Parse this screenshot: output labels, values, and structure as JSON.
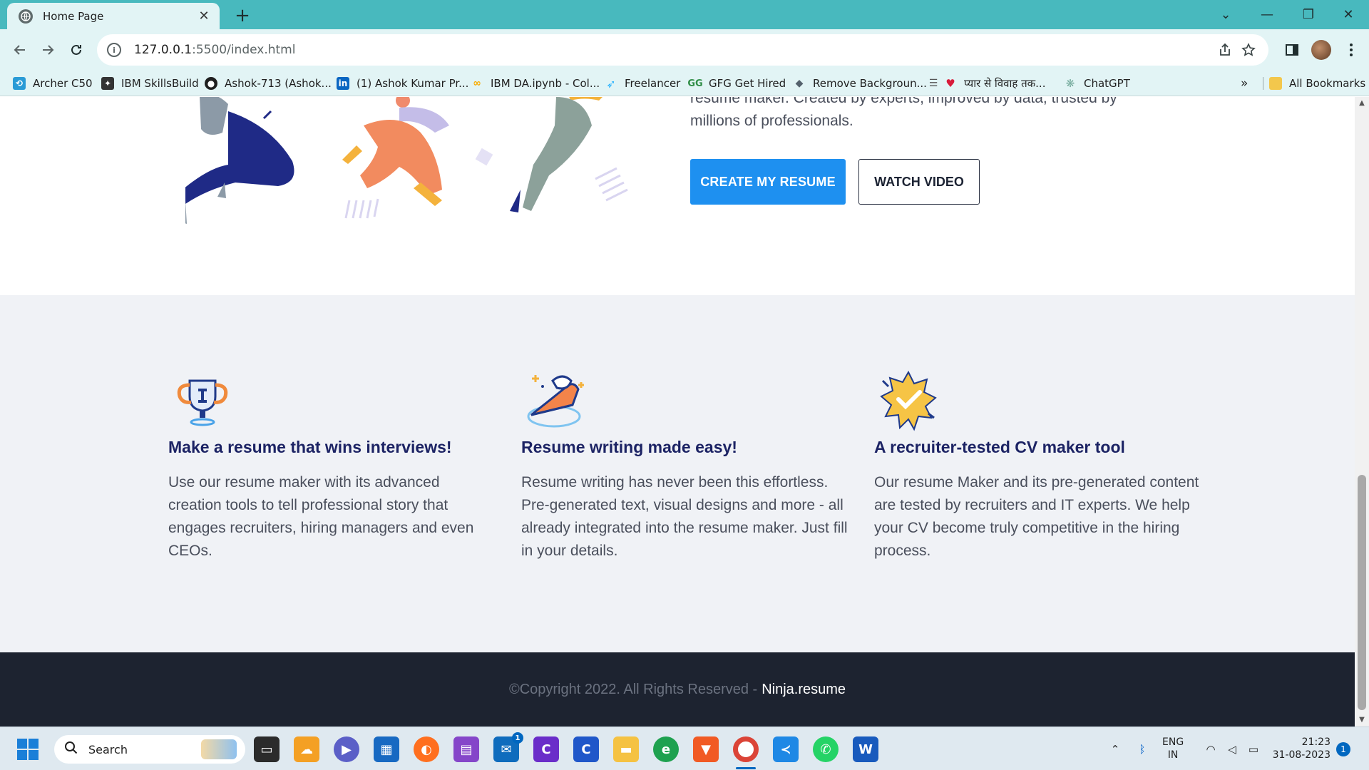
{
  "browser": {
    "tab_title": "Home Page",
    "tab_close": "✕",
    "new_tab": "+",
    "url_host": "127.0.0.1",
    "url_rest": ":5500/index.html",
    "window_controls": {
      "dropdown": "⌄",
      "minimize": "—",
      "restore": "❐",
      "close": "✕"
    }
  },
  "bookmarks": {
    "items": [
      {
        "label": "Archer C50",
        "icon": "tplink-icon",
        "color": "#2a9bd6"
      },
      {
        "label": "IBM SkillsBuild",
        "icon": "ibm-icon",
        "color": "#333333"
      },
      {
        "label": "Ashok-713 (Ashok...",
        "icon": "github-icon",
        "color": "#1f1f1f"
      },
      {
        "label": "(1) Ashok Kumar Pr...",
        "icon": "linkedin-icon",
        "color": "#0a66c2"
      },
      {
        "label": "IBM DA.ipynb - Col...",
        "icon": "colab-icon",
        "color": "#f9ab00"
      },
      {
        "label": "Freelancer",
        "icon": "freelancer-icon",
        "color": "#29b2fe"
      },
      {
        "label": "GFG Get Hired",
        "icon": "gfg-icon",
        "color": "#2f8d46"
      },
      {
        "label": "Remove Backgroun...",
        "icon": "removebg-icon",
        "color": "#54616c"
      },
      {
        "label": "प्यार से विवाह तक...",
        "icon": "heart-icon",
        "color": "#d81b3a"
      },
      {
        "label": "ChatGPT",
        "icon": "chatgpt-icon",
        "color": "#74aa9c"
      }
    ],
    "overflow": "»",
    "all_bookmarks": "All Bookmarks"
  },
  "hero": {
    "text_line1": "resume maker. Created by experts, improved by data, trusted by",
    "text_line2": "millions of professionals.",
    "primary_button": "CREATE MY RESUME",
    "secondary_button": "WATCH VIDEO"
  },
  "features": [
    {
      "icon": "trophy-icon",
      "title": "Make a resume that wins interviews!",
      "body": "Use our resume maker with its advanced creation tools to tell professional story that engages recruiters, hiring managers and even CEOs."
    },
    {
      "icon": "cake-slice-icon",
      "title": "Resume writing made easy!",
      "body": "Resume writing has never been this effortless. Pre-generated text, visual designs and more - all already integrated into the resume maker. Just fill in your details."
    },
    {
      "icon": "badge-check-icon",
      "title": "A recruiter-tested CV maker tool",
      "body": "Our resume Maker and its pre-generated content are tested by recruiters and IT experts. We help your CV become truly competitive in the hiring process."
    }
  ],
  "footer": {
    "copyright": "©Copyright 2022. All Rights Reserved -",
    "brand": "Ninja.resume"
  },
  "taskbar": {
    "search_placeholder": "Search",
    "mail_badge": "1",
    "language_line1": "ENG",
    "language_line2": "IN",
    "time": "21:23",
    "date": "31-08-2023",
    "notification_count": "1"
  },
  "colors": {
    "browser_frame": "#48b9be",
    "primary_button": "#1e90f0",
    "feature_title": "#1c2364",
    "footer_bg": "#1d2330"
  }
}
